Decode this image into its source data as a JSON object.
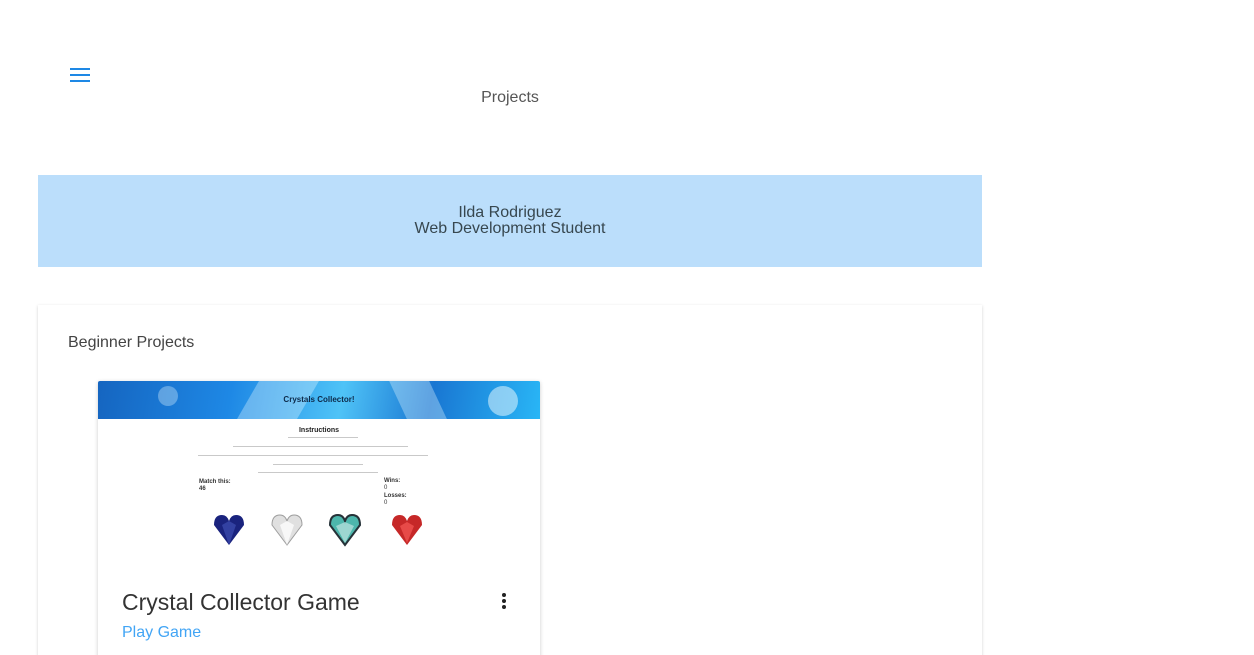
{
  "header": {
    "title": "Projects"
  },
  "banner": {
    "name": "Ilda Rodriguez",
    "role": "Web Development Student"
  },
  "section": {
    "title": "Beginner Projects",
    "cards": [
      {
        "title": "Crystal Collector Game",
        "link_label": "Play Game",
        "screenshot": {
          "header_title": "Crystals Collector!",
          "instructions_heading": "Instructions",
          "match_label": "Match this:",
          "match_value": "46",
          "wins_label": "Wins:",
          "wins_value": "0",
          "losses_label": "Losses:",
          "losses_value": "0"
        }
      }
    ]
  },
  "icons": {
    "menu": "menu-icon",
    "more": "more-vert-icon"
  },
  "colors": {
    "accent": "#1e88e5",
    "banner_bg": "#bbdefb",
    "link": "#42a5f5"
  }
}
